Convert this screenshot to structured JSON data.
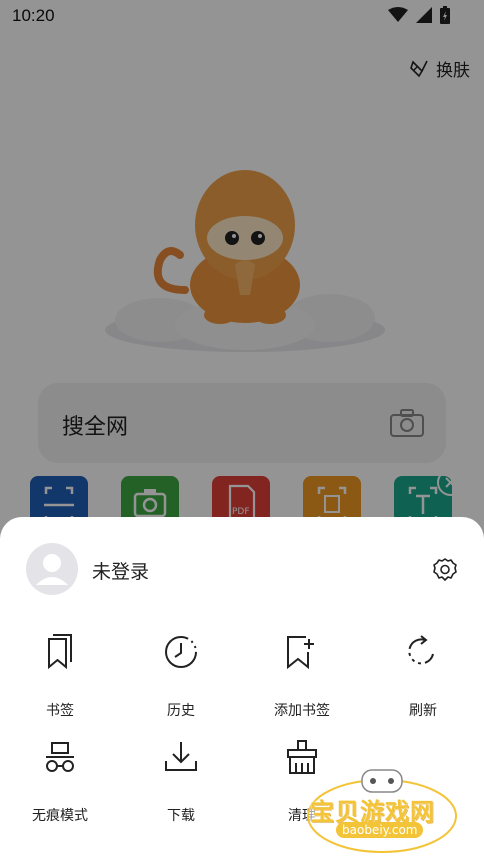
{
  "status_bar": {
    "time": "10:20"
  },
  "header": {
    "skin_label": "换肤"
  },
  "search": {
    "label": "搜全网"
  },
  "tools_row": {
    "colors": [
      "#1f5fb8",
      "#3fa742",
      "#e0413a",
      "#f09a22",
      "#1aa88e"
    ],
    "pdf_text": "PDF"
  },
  "sheet": {
    "login_label": "未登录",
    "items": [
      {
        "label": "书签",
        "icon": "bookmark-icon"
      },
      {
        "label": "历史",
        "icon": "history-icon"
      },
      {
        "label": "添加书签",
        "icon": "add-bookmark-icon"
      },
      {
        "label": "刷新",
        "icon": "refresh-icon"
      },
      {
        "label": "无痕模式",
        "icon": "incognito-icon"
      },
      {
        "label": "下载",
        "icon": "download-icon"
      },
      {
        "label": "清理",
        "icon": "clean-icon"
      }
    ]
  },
  "watermark": {
    "text": "宝贝游戏网",
    "url": "baobeiy.com"
  }
}
